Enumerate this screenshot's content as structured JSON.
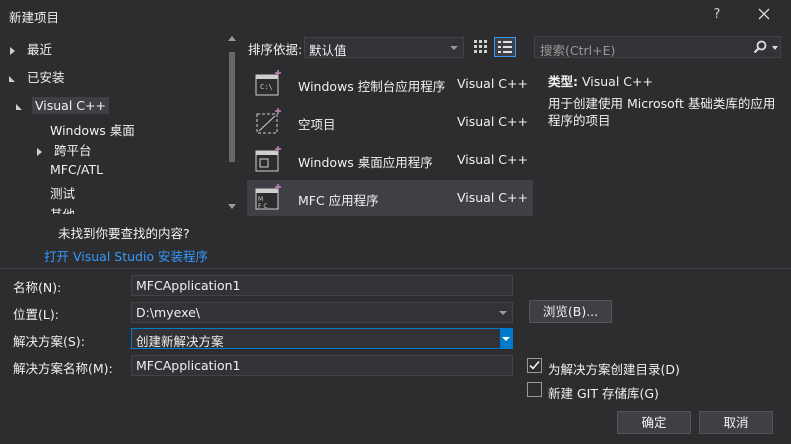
{
  "window": {
    "title": "新建项目",
    "help": "?",
    "close": "✕"
  },
  "tree": {
    "recent": "最近",
    "installed": "已安装",
    "visual_cpp": "Visual C++",
    "children": [
      "Windows 桌面",
      "跨平台",
      "MFC/ATL",
      "测试",
      "其他"
    ],
    "not_found": "未找到你要查找的内容?",
    "open_installer": "打开 Visual Studio 安装程序"
  },
  "sort": {
    "label": "排序依据:",
    "value": "默认值"
  },
  "templates": [
    {
      "name": "Windows 控制台应用程序",
      "lang": "Visual C++"
    },
    {
      "name": "空项目",
      "lang": "Visual C++"
    },
    {
      "name": "Windows 桌面应用程序",
      "lang": "Visual C++"
    },
    {
      "name": "MFC 应用程序",
      "lang": "Visual C++"
    }
  ],
  "search": {
    "placeholder": "搜索(Ctrl+E)"
  },
  "details": {
    "type_label": "类型:",
    "type_value": "Visual C++",
    "description": "用于创建使用 Microsoft 基础类库的应用程序的项目"
  },
  "form": {
    "name_label": "名称(N):",
    "name_value": "MFCApplication1",
    "location_label": "位置(L):",
    "location_value": "D:\\myexe\\",
    "browse": "浏览(B)...",
    "solution_label": "解决方案(S):",
    "solution_value": "创建新解决方案",
    "solution_name_label": "解决方案名称(M):",
    "solution_name_value": "MFCApplication1",
    "create_dir_label": "为解决方案创建目录(D)",
    "create_dir_checked": true,
    "git_label": "新建 GIT 存储库(G)",
    "git_checked": false,
    "ok": "确定",
    "cancel": "取消"
  },
  "colors": {
    "accent": "#007acc",
    "link": "#3399ff",
    "background": "#2d2d30",
    "selection": "#3f3f46"
  }
}
